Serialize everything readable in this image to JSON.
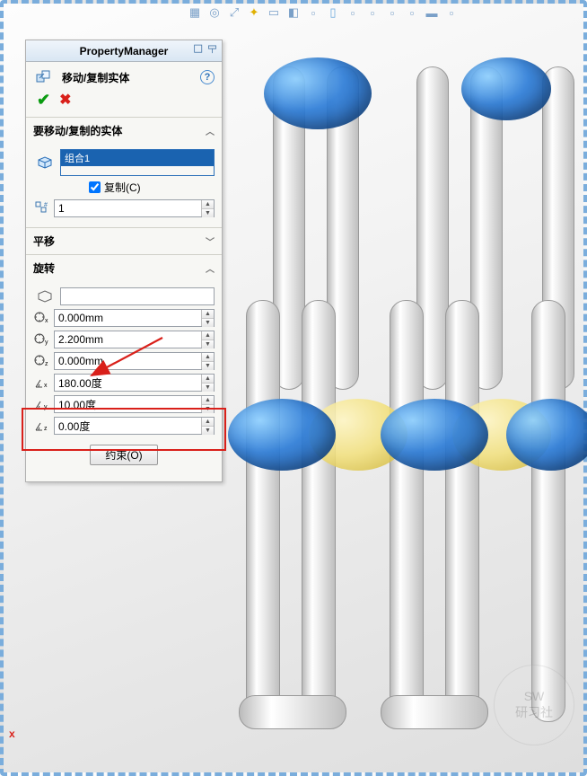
{
  "pm_title": "PropertyManager",
  "feature_title": "移动/复制实体",
  "sections": {
    "bodies": {
      "title": "要移动/复制的实体",
      "selected": "组合1",
      "copy_label": "复制(C)",
      "copy_checked": true,
      "count": "1"
    },
    "translate": {
      "title": "平移"
    },
    "rotate": {
      "title": "旋转",
      "cx": "0.000mm",
      "cy": "2.200mm",
      "cz": "0.000mm",
      "ax": "180.00度",
      "ay": "10.00度",
      "az": "0.00度"
    }
  },
  "constrain_btn": "约束(O)",
  "watermark": {
    "a": "SW",
    "b": "研习社"
  }
}
